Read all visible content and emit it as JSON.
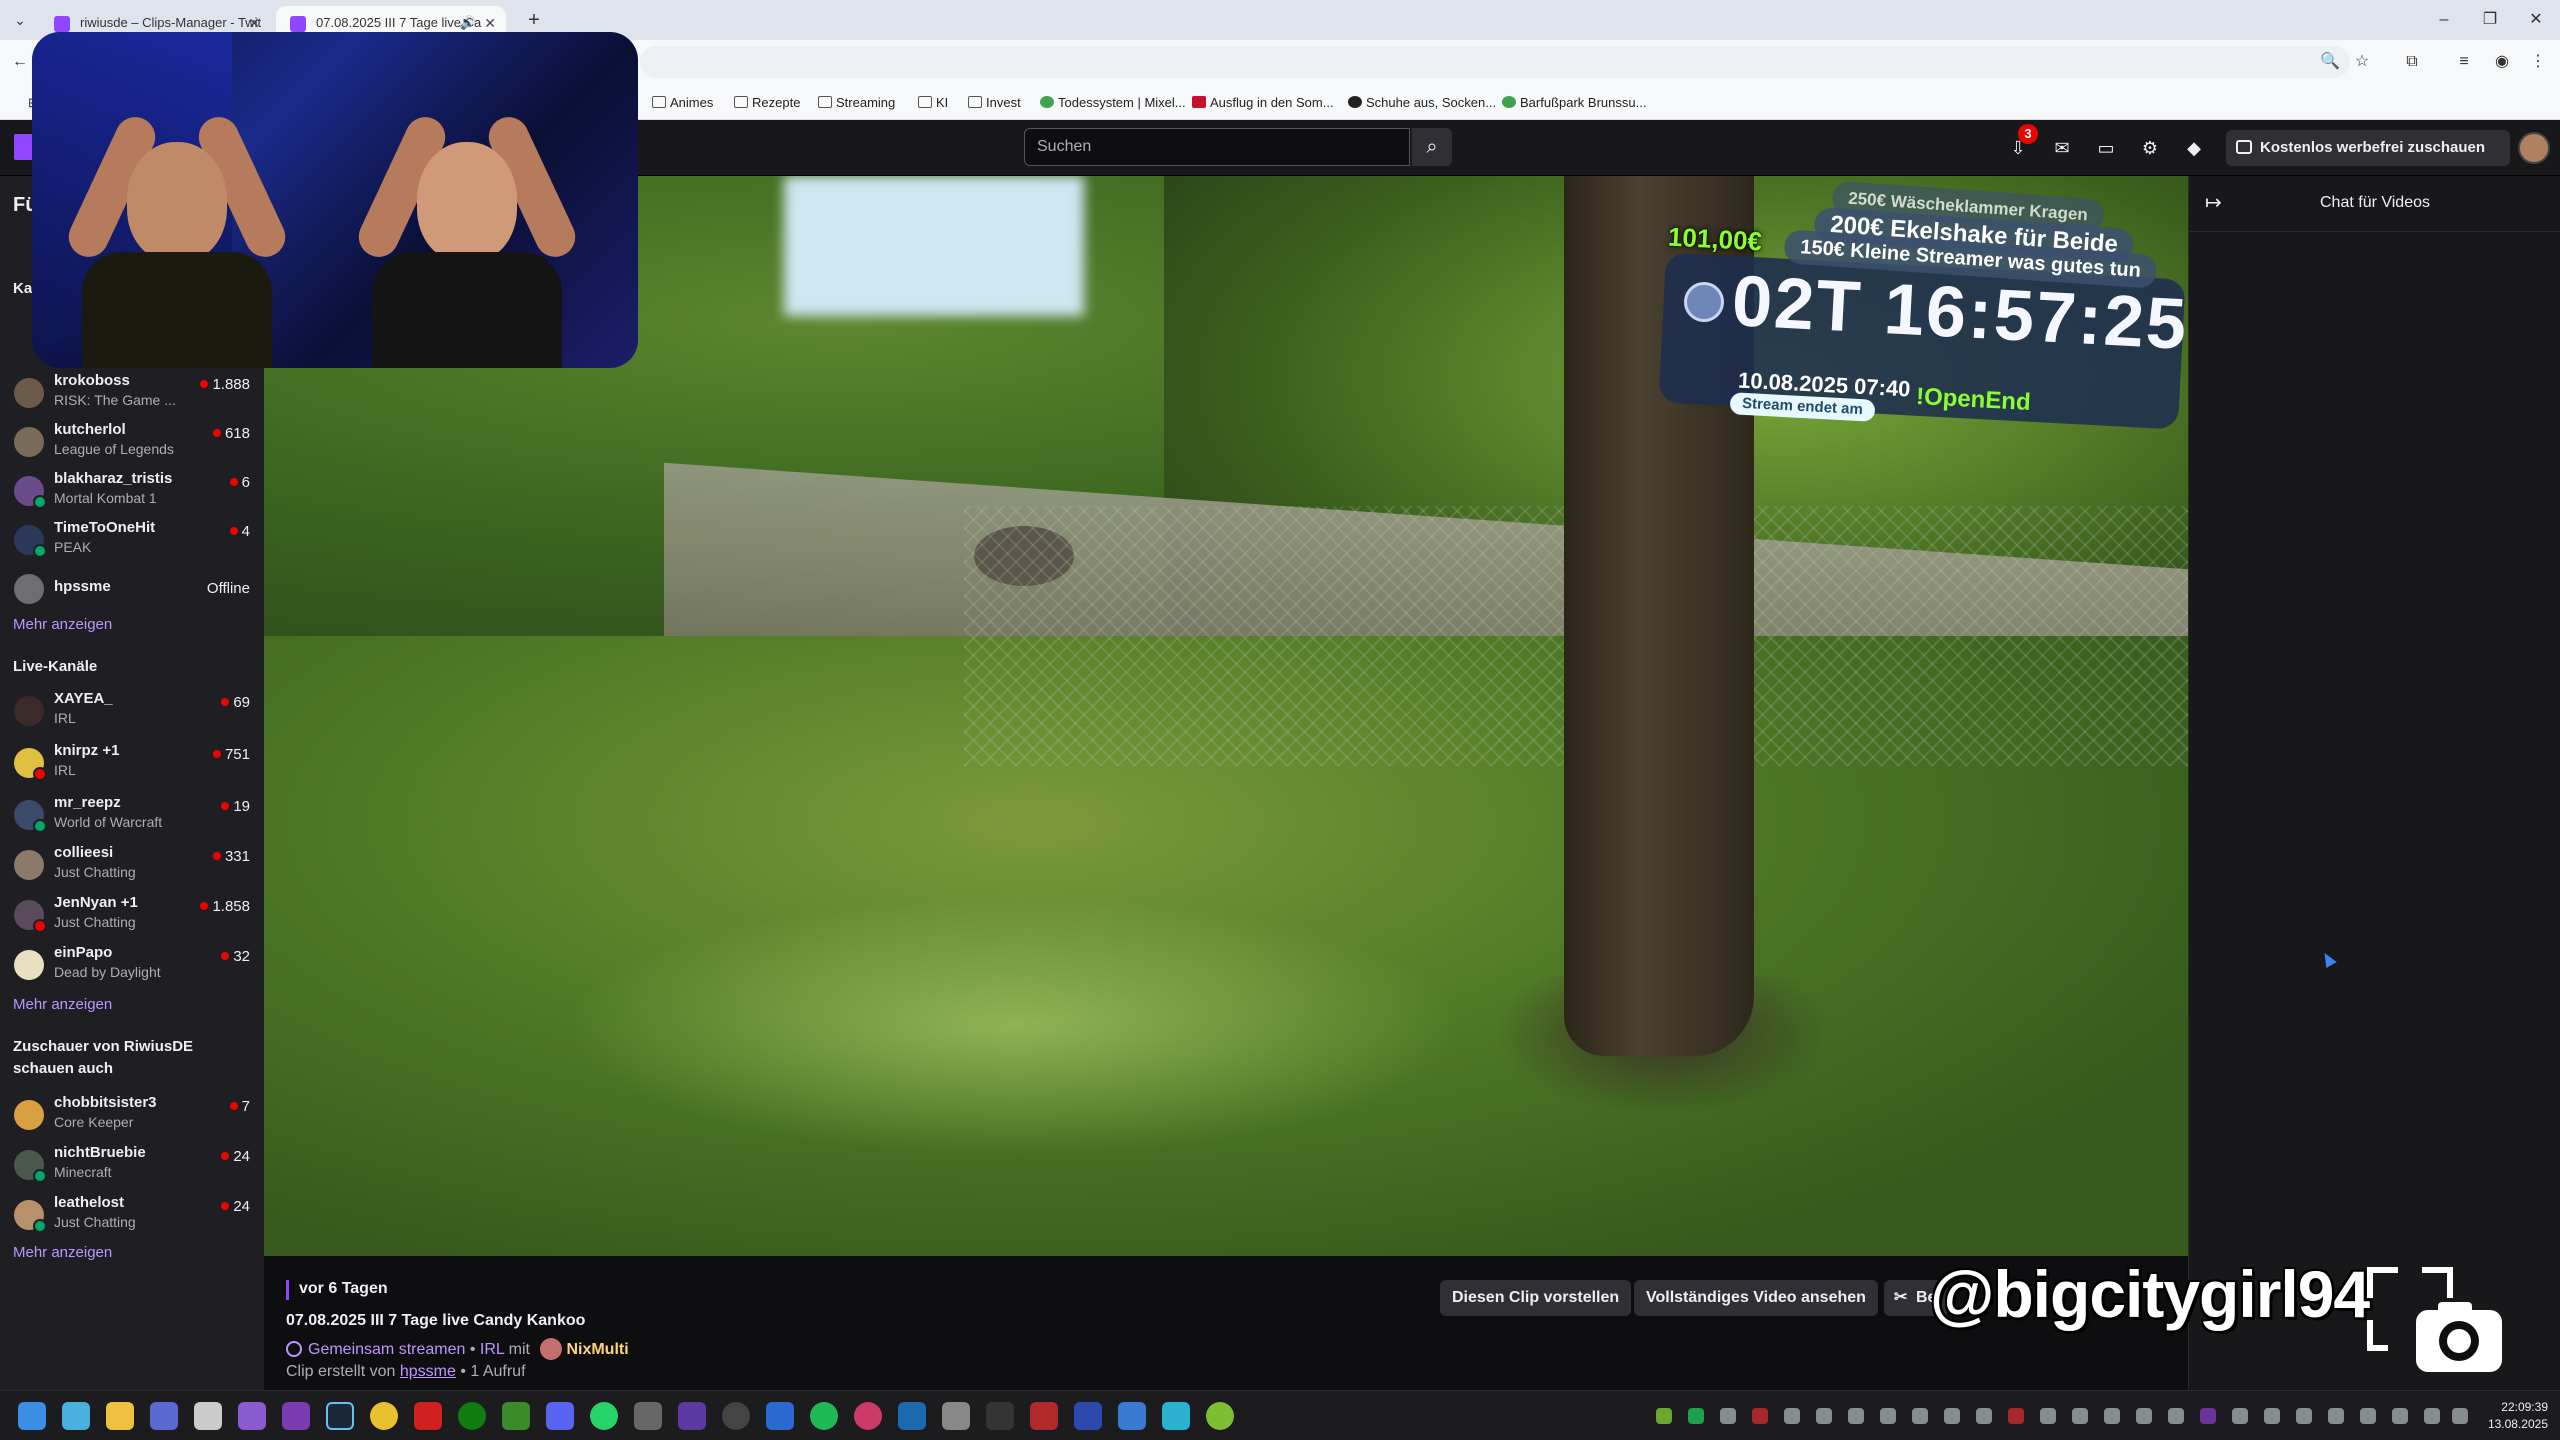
{
  "browser": {
    "tabs": [
      {
        "title": "riwiusde – Clips-Manager - Twit",
        "active": false
      },
      {
        "title": "07.08.2025 III 7 Tage live Ca",
        "active": true
      }
    ],
    "bookmarks": [
      "Animes",
      "Rezepte",
      "Streaming",
      "KI",
      "Invest",
      "Todessystem | Mixel...",
      "Ausflug in den Som...",
      "Schuhe aus, Socken...",
      "Barfußpark Brunssu..."
    ]
  },
  "topnav": {
    "search_placeholder": "Suchen",
    "notification_count": "3",
    "adfree_label": "Kostenlos werbefrei zuschauen"
  },
  "sidebar": {
    "followed_header": "Fü",
    "followed_subheader": "Ka",
    "followed": [
      {
        "name": "krokoboss",
        "game": "RISK: The Game ...",
        "viewers": "1.888"
      },
      {
        "name": "kutcherlol",
        "game": "League of Legends",
        "viewers": "618"
      },
      {
        "name": "blakharaz_tristis",
        "game": "Mortal Kombat 1",
        "viewers": "6"
      },
      {
        "name": "TimeToOneHit",
        "game": "PEAK",
        "viewers": "4"
      },
      {
        "name": "hpssme",
        "game": "",
        "viewers": "Offline"
      }
    ],
    "show_more": "Mehr anzeigen",
    "live_header": "Live-Kanäle",
    "live": [
      {
        "name": "XAYEA_",
        "game": "IRL",
        "viewers": "69"
      },
      {
        "name": "knirpz +1",
        "game": "IRL",
        "viewers": "751"
      },
      {
        "name": "mr_reepz",
        "game": "World of Warcraft",
        "viewers": "19"
      },
      {
        "name": "collieesi",
        "game": "Just Chatting",
        "viewers": "331"
      },
      {
        "name": "JenNyan +1",
        "game": "Just Chatting",
        "viewers": "1.858"
      },
      {
        "name": "einPapo",
        "game": "Dead by Daylight",
        "viewers": "32"
      }
    ],
    "viewers_also_header_line1": "Zuschauer von RiwiusDE",
    "viewers_also_header_line2": "schauen auch",
    "viewers_also": [
      {
        "name": "chobbitsister3",
        "game": "Core Keeper",
        "viewers": "7"
      },
      {
        "name": "nichtBruebie",
        "game": "Minecraft",
        "viewers": "24"
      },
      {
        "name": "leathelost",
        "game": "Just Chatting",
        "viewers": "24"
      }
    ]
  },
  "overlay": {
    "amount": "101,00€",
    "goals": [
      "250€ Wäscheklammer Kragen",
      "200€ Ekelshake für Beide",
      "150€ Kleine Streamer was gutes tun"
    ],
    "timer": "02T 16:57:25",
    "end_date": "10.08.2025 07:40",
    "open_end": "!OpenEnd",
    "ends_label": "Stream endet am"
  },
  "chat": {
    "title": "Chat für Videos"
  },
  "clip_info": {
    "age": "vor 6 Tagen",
    "title": "07.08.2025 III 7 Tage live Candy Kankoo",
    "collab_label": "Gemeinsam streamen",
    "category": "IRL",
    "with": "mit",
    "partner": "NixMulti",
    "clip_by": "Clip erstellt von",
    "clip_author": "hpssme",
    "views": "1 Aufruf",
    "btn_share": "Diesen Clip vorstellen",
    "btn_full": "Vollständiges Video ansehen",
    "btn_edit": "Be"
  },
  "watermark": "@bigcitygirl94",
  "taskbar": {
    "time": "22:09:39",
    "date": "13.08.2025"
  }
}
